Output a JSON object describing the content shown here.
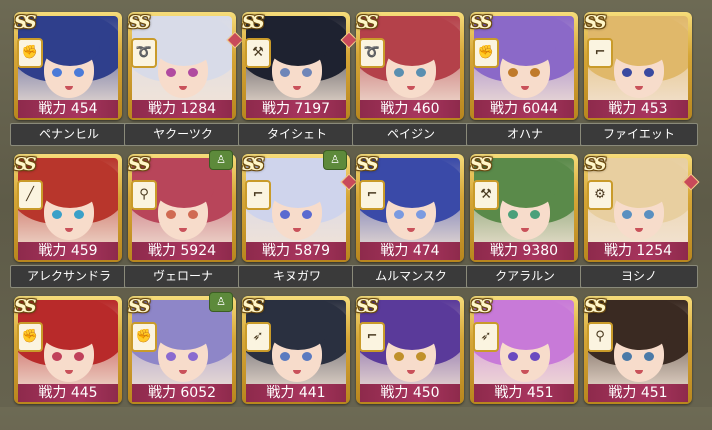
{
  "power_prefix": "戦力",
  "rank_label": "SS",
  "characters": [
    {
      "power": "454",
      "name": "ペナンヒル",
      "weapon": "fist-icon",
      "hair": "#2f3f8c",
      "eye": "#4b7bd8",
      "gem": false,
      "badge": false
    },
    {
      "power": "1284",
      "name": "ヤクーツク",
      "weapon": "whip-icon",
      "hair": "#d8dbe8",
      "eye": "#b04ba0",
      "gem": true,
      "badge": false
    },
    {
      "power": "7197",
      "name": "タイシェト",
      "weapon": "axe-icon",
      "hair": "#1e2230",
      "eye": "#6f86b8",
      "gem": true,
      "badge": false
    },
    {
      "power": "460",
      "name": "ペイジン",
      "weapon": "whip-icon",
      "hair": "#b4414a",
      "eye": "#5a8fb0",
      "gem": false,
      "badge": false
    },
    {
      "power": "6044",
      "name": "オハナ",
      "weapon": "fist-icon",
      "hair": "#8b69c8",
      "eye": "#c07a2a",
      "gem": false,
      "badge": false
    },
    {
      "power": "453",
      "name": "ファイエット",
      "weapon": "gun-icon",
      "hair": "#e0b86a",
      "eye": "#3a4aa0",
      "gem": false,
      "badge": false
    },
    {
      "power": "459",
      "name": "アレクサンドラ",
      "weapon": "sword-icon",
      "hair": "#b8362c",
      "eye": "#3aa0c8",
      "gem": false,
      "badge": false
    },
    {
      "power": "5924",
      "name": "ヴェローナ",
      "weapon": "pin-icon",
      "hair": "#b8455a",
      "eye": "#d06a52",
      "gem": false,
      "badge": true
    },
    {
      "power": "5879",
      "name": "キヌガワ",
      "weapon": "gun-icon",
      "hair": "#cfd4ec",
      "eye": "#5a6ad0",
      "gem": true,
      "badge": true
    },
    {
      "power": "474",
      "name": "ムルマンスク",
      "weapon": "gun-icon",
      "hair": "#3a4aa8",
      "eye": "#7a9ae0",
      "gem": false,
      "badge": false
    },
    {
      "power": "9380",
      "name": "クアラルン",
      "weapon": "axe-icon",
      "hair": "#5a8a4a",
      "eye": "#4aa07a",
      "gem": false,
      "badge": false
    },
    {
      "power": "1254",
      "name": "ヨシノ",
      "weapon": "tools-icon",
      "hair": "#e8cfa0",
      "eye": "#5a90c0",
      "gem": true,
      "badge": false
    },
    {
      "power": "445",
      "name": "",
      "weapon": "fist-icon",
      "hair": "#b82a2a",
      "eye": "#c0405a",
      "gem": false,
      "badge": false
    },
    {
      "power": "6052",
      "name": "",
      "weapon": "fist-icon",
      "hair": "#8e86c8",
      "eye": "#8a6ad0",
      "gem": false,
      "badge": true
    },
    {
      "power": "441",
      "name": "",
      "weapon": "bow-icon",
      "hair": "#2a3040",
      "eye": "#5a7ac0",
      "gem": false,
      "badge": false
    },
    {
      "power": "450",
      "name": "",
      "weapon": "gun-icon",
      "hair": "#5a3a9a",
      "eye": "#c0902a",
      "gem": false,
      "badge": false
    },
    {
      "power": "451",
      "name": "",
      "weapon": "bow-icon",
      "hair": "#c87ad8",
      "eye": "#6a4ac0",
      "gem": false,
      "badge": false
    },
    {
      "power": "451",
      "name": "",
      "weapon": "pin-icon",
      "hair": "#3a2a22",
      "eye": "#4a7aa8",
      "gem": false,
      "badge": false
    }
  ]
}
